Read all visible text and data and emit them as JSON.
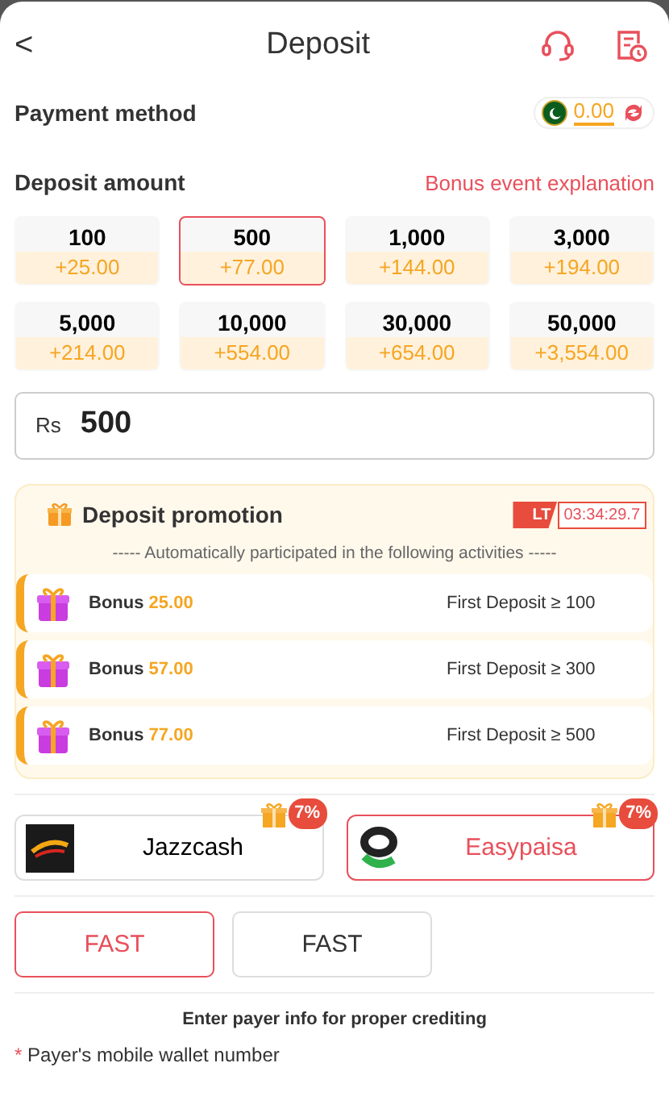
{
  "header": {
    "back": "<",
    "title": "Deposit"
  },
  "payment_method": {
    "label": "Payment method",
    "balance": "0.00"
  },
  "deposit_amount": {
    "label": "Deposit amount",
    "link": "Bonus event explanation"
  },
  "amounts": [
    {
      "amount": "100",
      "bonus": "+25.00",
      "selected": false
    },
    {
      "amount": "500",
      "bonus": "+77.00",
      "selected": true
    },
    {
      "amount": "1,000",
      "bonus": "+144.00",
      "selected": false
    },
    {
      "amount": "3,000",
      "bonus": "+194.00",
      "selected": false
    },
    {
      "amount": "5,000",
      "bonus": "+214.00",
      "selected": false
    },
    {
      "amount": "10,000",
      "bonus": "+554.00",
      "selected": false
    },
    {
      "amount": "30,000",
      "bonus": "+654.00",
      "selected": false
    },
    {
      "amount": "50,000",
      "bonus": "+3,554.00",
      "selected": false
    }
  ],
  "amount_field": {
    "currency": "Rs",
    "value": "500"
  },
  "promotion": {
    "title": "Deposit promotion",
    "tag": "LT",
    "timer": "03:34:29.7",
    "subtitle": "----- Automatically participated in the following activities -----",
    "items": [
      {
        "label": "Bonus",
        "bonus": "25.00",
        "condition": "First Deposit ≥ 100"
      },
      {
        "label": "Bonus",
        "bonus": "57.00",
        "condition": "First Deposit ≥ 300"
      },
      {
        "label": "Bonus",
        "bonus": "77.00",
        "condition": "First Deposit ≥ 500"
      }
    ]
  },
  "methods": [
    {
      "name": "Jazzcash",
      "kind": "jazz",
      "badge": "7%",
      "selected": false
    },
    {
      "name": "Easypaisa",
      "kind": "easy",
      "badge": "7%",
      "selected": true
    }
  ],
  "channels": [
    {
      "name": "FAST",
      "selected": true
    },
    {
      "name": "FAST",
      "selected": false
    }
  ],
  "payer_info": {
    "title": "Enter payer info for proper crediting",
    "required_mark": "*",
    "field_label": "Payer's mobile wallet number"
  }
}
